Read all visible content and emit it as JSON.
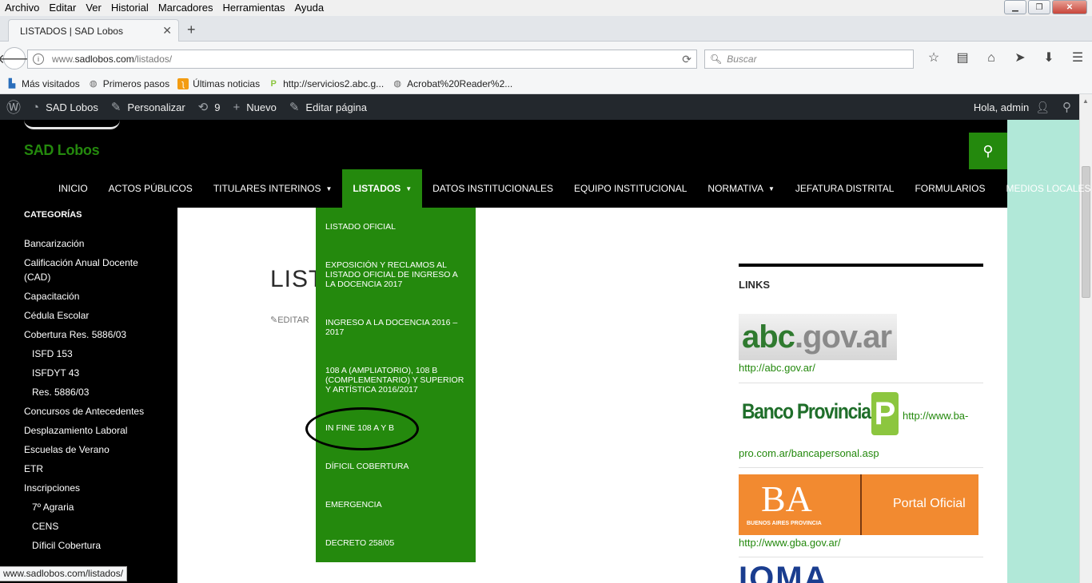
{
  "browser": {
    "menu": [
      "Archivo",
      "Editar",
      "Ver",
      "Historial",
      "Marcadores",
      "Herramientas",
      "Ayuda"
    ],
    "tab_title": "LISTADOS | SAD Lobos",
    "url_prefix": "www.",
    "url_domain": "sadlobos.com",
    "url_path": "/listados/",
    "search_placeholder": "Buscar",
    "bookmarks": [
      "Más visitados",
      "Primeros pasos",
      "Últimas noticias",
      "http://servicios2.abc.g...",
      "Acrobat%20Reader%2..."
    ]
  },
  "adminbar": {
    "site": "SAD Lobos",
    "customize": "Personalizar",
    "updates": "9",
    "new": "Nuevo",
    "edit_page": "Editar página",
    "greeting": "Hola, admin"
  },
  "site": {
    "title": "SAD Lobos",
    "nav": [
      {
        "label": "INICIO",
        "caret": ""
      },
      {
        "label": "ACTOS PÚBLICOS",
        "caret": ""
      },
      {
        "label": "TITULARES INTERINOS",
        "caret": "▼"
      },
      {
        "label": "LISTADOS",
        "caret": "▼"
      },
      {
        "label": "DATOS INSTITUCIONALES",
        "caret": ""
      },
      {
        "label": "EQUIPO INSTITUCIONAL",
        "caret": ""
      },
      {
        "label": "NORMATIVA",
        "caret": "▼"
      },
      {
        "label": "JEFATURA DISTRITAL",
        "caret": ""
      },
      {
        "label": "FORMULARIOS",
        "caret": ""
      },
      {
        "label": "MEDIOS LOCALES",
        "caret": ""
      }
    ],
    "dropdown": [
      "LISTADO OFICIAL",
      "EXPOSICIÓN Y RECLAMOS AL LISTADO OFICIAL DE INGRESO A LA DOCENCIA 2017",
      "INGRESO A LA DOCENCIA 2016 – 2017",
      "108 A (AMPLIATORIO), 108 B (COMPLEMENTARIO) Y SUPERIOR Y ARTÍSTICA 2016/2017",
      "IN FINE 108 A Y B",
      "DÍFICIL COBERTURA",
      "EMERGENCIA",
      "DECRETO 258/05"
    ],
    "categories_title": "CATEGORÍAS",
    "categories": [
      {
        "label": "Bancarización",
        "sub": false
      },
      {
        "label": "Calificación Anual Docente (CAD)",
        "sub": false
      },
      {
        "label": "Capacitación",
        "sub": false
      },
      {
        "label": "Cédula Escolar",
        "sub": false
      },
      {
        "label": "Cobertura Res. 5886/03",
        "sub": false
      },
      {
        "label": "ISFD 153",
        "sub": true
      },
      {
        "label": "ISFDYT 43",
        "sub": true
      },
      {
        "label": "Res. 5886/03",
        "sub": true
      },
      {
        "label": "Concursos de Antecedentes",
        "sub": false
      },
      {
        "label": "Desplazamiento Laboral",
        "sub": false
      },
      {
        "label": "Escuelas de Verano",
        "sub": false
      },
      {
        "label": "ETR",
        "sub": false
      },
      {
        "label": "Inscripciones",
        "sub": false
      },
      {
        "label": "7º Agraria",
        "sub": true
      },
      {
        "label": "CENS",
        "sub": true
      },
      {
        "label": "Díficil Cobertura",
        "sub": true
      }
    ],
    "page_title": "LIST",
    "edit_link": "EDITAR",
    "links_title": "LINKS",
    "abc_logo_1": "abc",
    "abc_logo_2": ".gov.ar",
    "abc_url": "http://abc.gov.ar/",
    "bp_logo": "Banco Provincia",
    "bp_p": "P",
    "bp_url_1": "http://www.ba-",
    "bp_url_2": "pro.com.ar/bancapersonal.asp",
    "ba_logo": "BA",
    "ba_sub": "BUENOS AIRES PROVINCIA",
    "ba_portal": "Portal Oficial",
    "gba_url": "http://www.gba.gov.ar/",
    "ioma_logo": "IOMA"
  },
  "statusbar": "www.sadlobos.com/listados/",
  "colors": {
    "accent": "#24890d",
    "adminbar": "#23282d",
    "mint": "#b1e8d8"
  }
}
